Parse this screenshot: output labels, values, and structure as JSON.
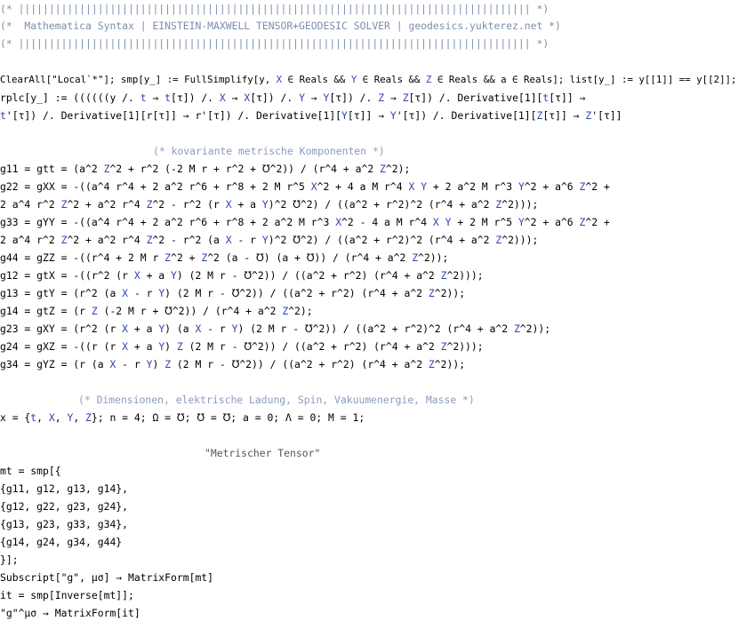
{
  "notebook": {
    "header": {
      "bar1": "(* |||||||||||||||||||||||||||||||||||||||||||||||||||||||||||||||||||||||||||||||||||| *)",
      "title": "(*  Mathematica Syntax | EINSTEIN-MAXWELL TENSOR+GEODESIC SOLVER | geodesics.yukterez.net *)",
      "bar2": "(* |||||||||||||||||||||||||||||||||||||||||||||||||||||||||||||||||||||||||||||||||||| *)"
    },
    "setup": {
      "l1": "ClearAll[\"Local`*\"]; smp[y_] := FullSimplify[y, X ∈ Reals && Y ∈ Reals && Z ∈ Reals && a ∈ Reals]; list[y_] := y[[1]] == y[[2]];",
      "l2": "rplc[y_] := ((((((y /. t → t[τ]) /. X → X[τ]) /. Y → Y[τ]) /. Z → Z[τ]) /. Derivative[1][t[τ]] →",
      "l3": "t'[τ]) /. Derivative[1][r[τ]] → r'[τ]) /. Derivative[1][Y[τ]] → Y'[τ]) /. Derivative[1][Z[τ]] → Z'[τ]]"
    },
    "metric_components": {
      "comment": "(* kovariante metrische Komponenten *)",
      "lines": [
        "g11 = gtt = (a^2 Z^2 + r^2 (-2 M r + r^2 + ℧^2)) / (r^4 + a^2 Z^2);",
        "g22 = gXX = -((a^4 r^4 + 2 a^2 r^6 + r^8 + 2 M r^5 X^2 + 4 a M r^4 X Y + 2 a^2 M r^3 Y^2 + a^6 Z^2 +",
        "2 a^4 r^2 Z^2 + a^2 r^4 Z^2 - r^2 (r X + a Y)^2 ℧^2) / ((a^2 + r^2)^2 (r^4 + a^2 Z^2)));",
        "g33 = gYY = -((a^4 r^4 + 2 a^2 r^6 + r^8 + 2 a^2 M r^3 X^2 - 4 a M r^4 X Y + 2 M r^5 Y^2 + a^6 Z^2 +",
        "2 a^4 r^2 Z^2 + a^2 r^4 Z^2 - r^2 (a X - r Y)^2 ℧^2) / ((a^2 + r^2)^2 (r^4 + a^2 Z^2)));",
        "g44 = gZZ = -((r^4 + 2 M r Z^2 + Z^2 (a - ℧) (a + ℧)) / (r^4 + a^2 Z^2));",
        "g12 = gtX = -((r^2 (r X + a Y) (2 M r - ℧^2)) / ((a^2 + r^2) (r^4 + a^2 Z^2)));",
        "g13 = gtY = (r^2 (a X - r Y) (2 M r - ℧^2)) / ((a^2 + r^2) (r^4 + a^2 Z^2));",
        "g14 = gtZ = (r Z (-2 M r + ℧^2)) / (r^4 + a^2 Z^2);",
        "g23 = gXY = (r^2 (r X + a Y) (a X - r Y) (2 M r - ℧^2)) / ((a^2 + r^2)^2 (r^4 + a^2 Z^2));",
        "g24 = gXZ = -((r (r X + a Y) Z (2 M r - ℧^2)) / ((a^2 + r^2) (r^4 + a^2 Z^2)));",
        "g34 = gYZ = (r (a X - r Y) Z (2 M r - ℧^2)) / ((a^2 + r^2) (r^4 + a^2 Z^2));"
      ]
    },
    "dimensions": {
      "comment": "(* Dimensionen, elektrische Ladung, Spin, Vakuumenergie, Masse *)",
      "line": "x = {t, X, Y, Z}; n = 4; Ω = ℧; ℧ = ℧; a = 0; Λ = 0; M = 1;"
    },
    "tensor": {
      "title_string": "\"Metrischer Tensor\"",
      "lines": [
        "mt = smp[{",
        "{g11, g12, g13, g14},",
        "{g12, g22, g23, g24},",
        "{g13, g23, g33, g34},",
        "{g14, g24, g34, g44}",
        "}];",
        "Subscript[\"g\", μσ] → MatrixForm[mt]",
        "it = smp[Inverse[mt]];",
        "\"g\"^μσ → MatrixForm[it]"
      ]
    }
  }
}
